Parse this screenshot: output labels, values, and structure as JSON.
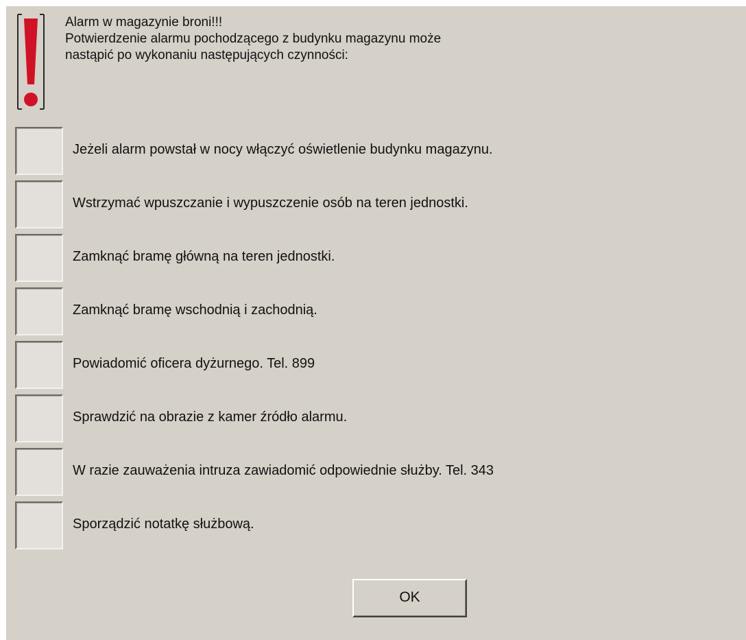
{
  "dialog": {
    "icon": "exclamation-icon",
    "message_lines": [
      "Alarm w magazynie broni!!!",
      "Potwierdzenie alarmu pochodzącego z budynku magazynu może",
      "nastąpić po wykonaniu następujących czynności:"
    ],
    "steps": [
      {
        "label": "Jeżeli alarm powstał w nocy włączyć oświetlenie budynku magazynu.",
        "checked": false
      },
      {
        "label": "Wstrzymać wpuszczanie i wypuszczenie osób na teren jednostki.",
        "checked": false
      },
      {
        "label": "Zamknąć bramę główną na teren jednostki.",
        "checked": false
      },
      {
        "label": "Zamknąć bramę wschodnią i zachodnią.",
        "checked": false
      },
      {
        "label": "Powiadomić oficera dyżurnego. Tel. 899",
        "checked": false
      },
      {
        "label": "Sprawdzić na obrazie z kamer źródło alarmu.",
        "checked": false
      },
      {
        "label": "W razie zauważenia intruza zawiadomić odpowiednie służby. Tel. 343",
        "checked": false
      },
      {
        "label": "Sporządzić notatkę służbową.",
        "checked": false
      }
    ],
    "ok_label": "OK",
    "colors": {
      "background": "#d5d0c8",
      "alert_red": "#d01226"
    }
  }
}
